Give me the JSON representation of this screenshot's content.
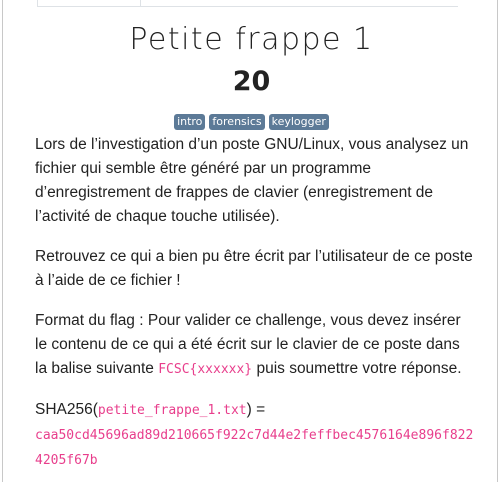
{
  "challenge": {
    "title": "Petite frappe 1",
    "points": "20",
    "tags": [
      "intro",
      "forensics",
      "keylogger"
    ]
  },
  "description": {
    "p1": "Lors de l’investigation d’un poste GNU/Linux, vous analysez un fichier qui semble être généré par un programme d’enregistrement de frappes de clavier (enregistrement de l’activité de chaque touche utilisée).",
    "p2": "Retrouvez ce qui a bien pu être écrit par l’utilisateur de ce poste à l’aide de ce fichier !",
    "p3_before": "Format du flag : Pour valider ce challenge, vous devez insérer le contenu de ce qui a été écrit sur le clavier de ce poste dans la balise suivante ",
    "p3_code": "FCSC{xxxxxx}",
    "p3_after": " puis soumettre votre réponse.",
    "sha_prefix": "SHA256(",
    "sha_filename": "petite_frappe_1.txt",
    "sha_suffix": ") =",
    "sha_value": "caa50cd45696ad89d210665f922c7d44e2feffbec4576164e896f8224205f67b"
  },
  "colors": {
    "tag_bg": "#5c7a97",
    "code": "#e83e8c"
  }
}
